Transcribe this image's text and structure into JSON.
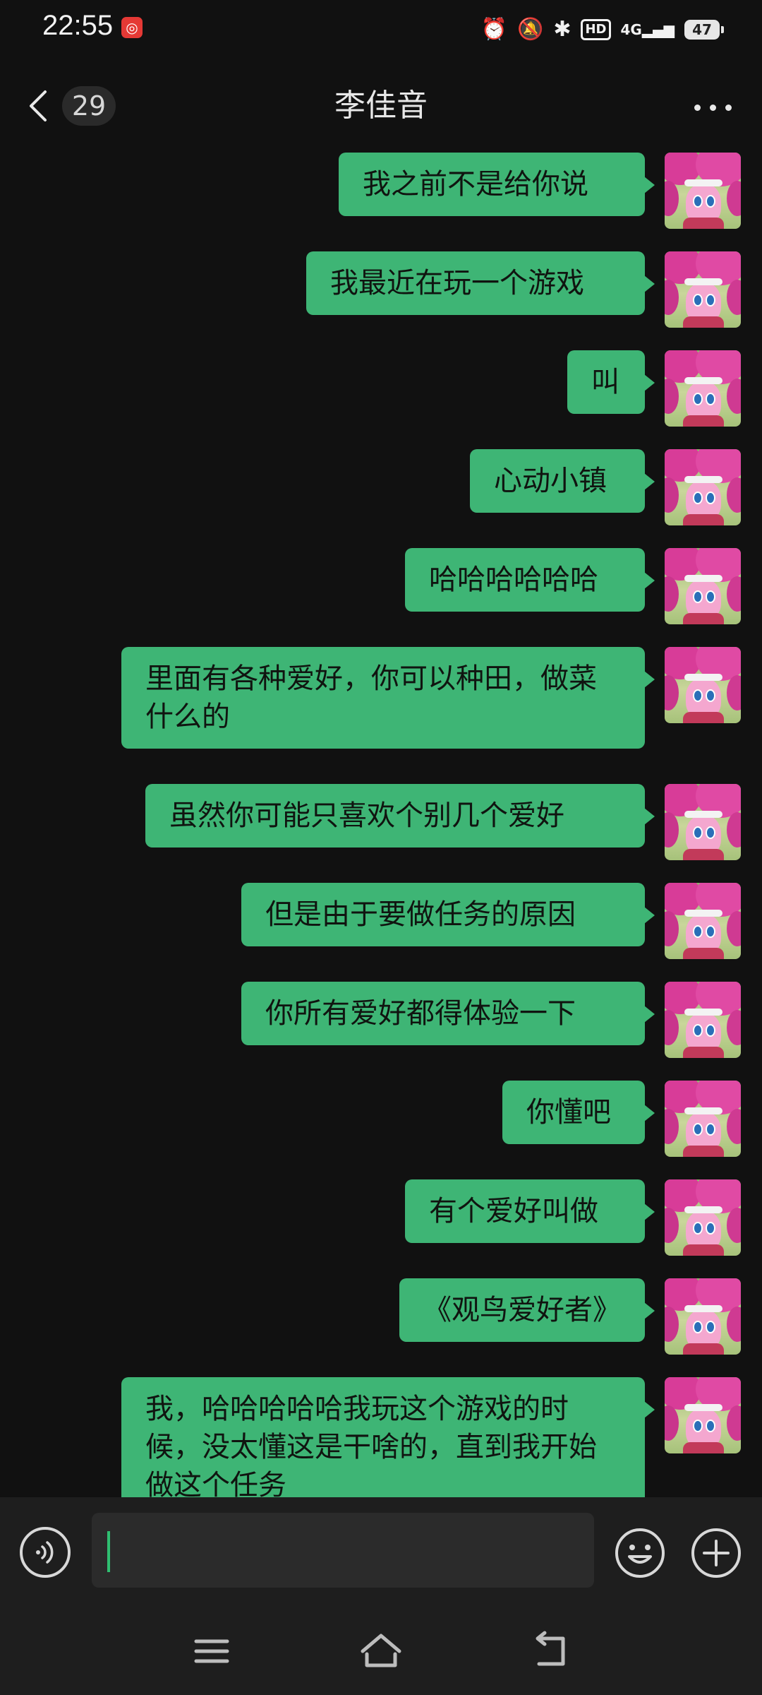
{
  "status_bar": {
    "time": "22:55",
    "app_icon_glyph": "◎",
    "battery": "47",
    "icons": [
      "alarm-icon",
      "mute-icon",
      "bluetooth-icon",
      "hd-icon",
      "signal-4g-icon",
      "battery-icon"
    ],
    "hd_label": "HD",
    "network_label": "4G"
  },
  "header": {
    "unread_count": "29",
    "title": "李佳音"
  },
  "messages": [
    "我之前不是给你说",
    "我最近在玩一个游戏",
    "叫",
    "心动小镇",
    "哈哈哈哈哈哈",
    "里面有各种爱好，你可以种田，做菜什么的",
    "虽然你可能只喜欢个别几个爱好",
    "但是由于要做任务的原因",
    "你所有爱好都得体验一下",
    "你懂吧",
    "有个爱好叫做",
    "《观鸟爱好者》",
    "我，哈哈哈哈哈我玩这个游戏的时候，没太懂这是干啥的，直到我开始做这个任务"
  ],
  "input": {
    "value": ""
  },
  "colors": {
    "bubble": "#3eb575",
    "background": "#111111",
    "input_bar": "#1e1e1e",
    "caret": "#2fbf71"
  }
}
